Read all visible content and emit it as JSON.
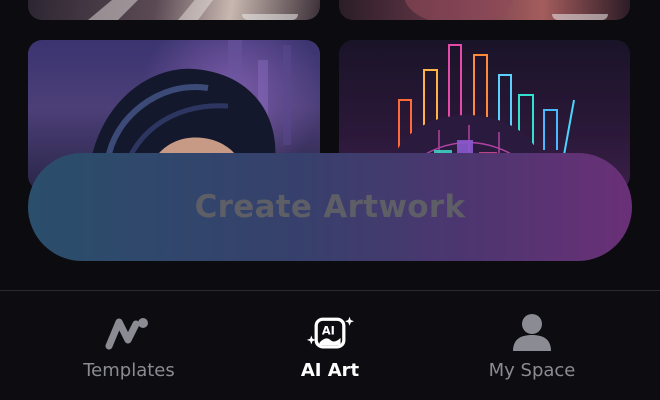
{
  "main": {
    "create_button_label": "Create Artwork"
  },
  "tabbar": {
    "tabs": [
      {
        "label": "Templates",
        "icon": "templates-icon",
        "active": false
      },
      {
        "label": "AI Art",
        "icon": "ai-art-icon",
        "active": true
      },
      {
        "label": "My Space",
        "icon": "user-icon",
        "active": false
      }
    ]
  },
  "colors": {
    "background": "#0c0c10",
    "button_gradient_start": "#2a4e6b",
    "button_gradient_end": "#6a3077",
    "tab_inactive": "#8b8b93",
    "tab_active": "#ffffff"
  }
}
